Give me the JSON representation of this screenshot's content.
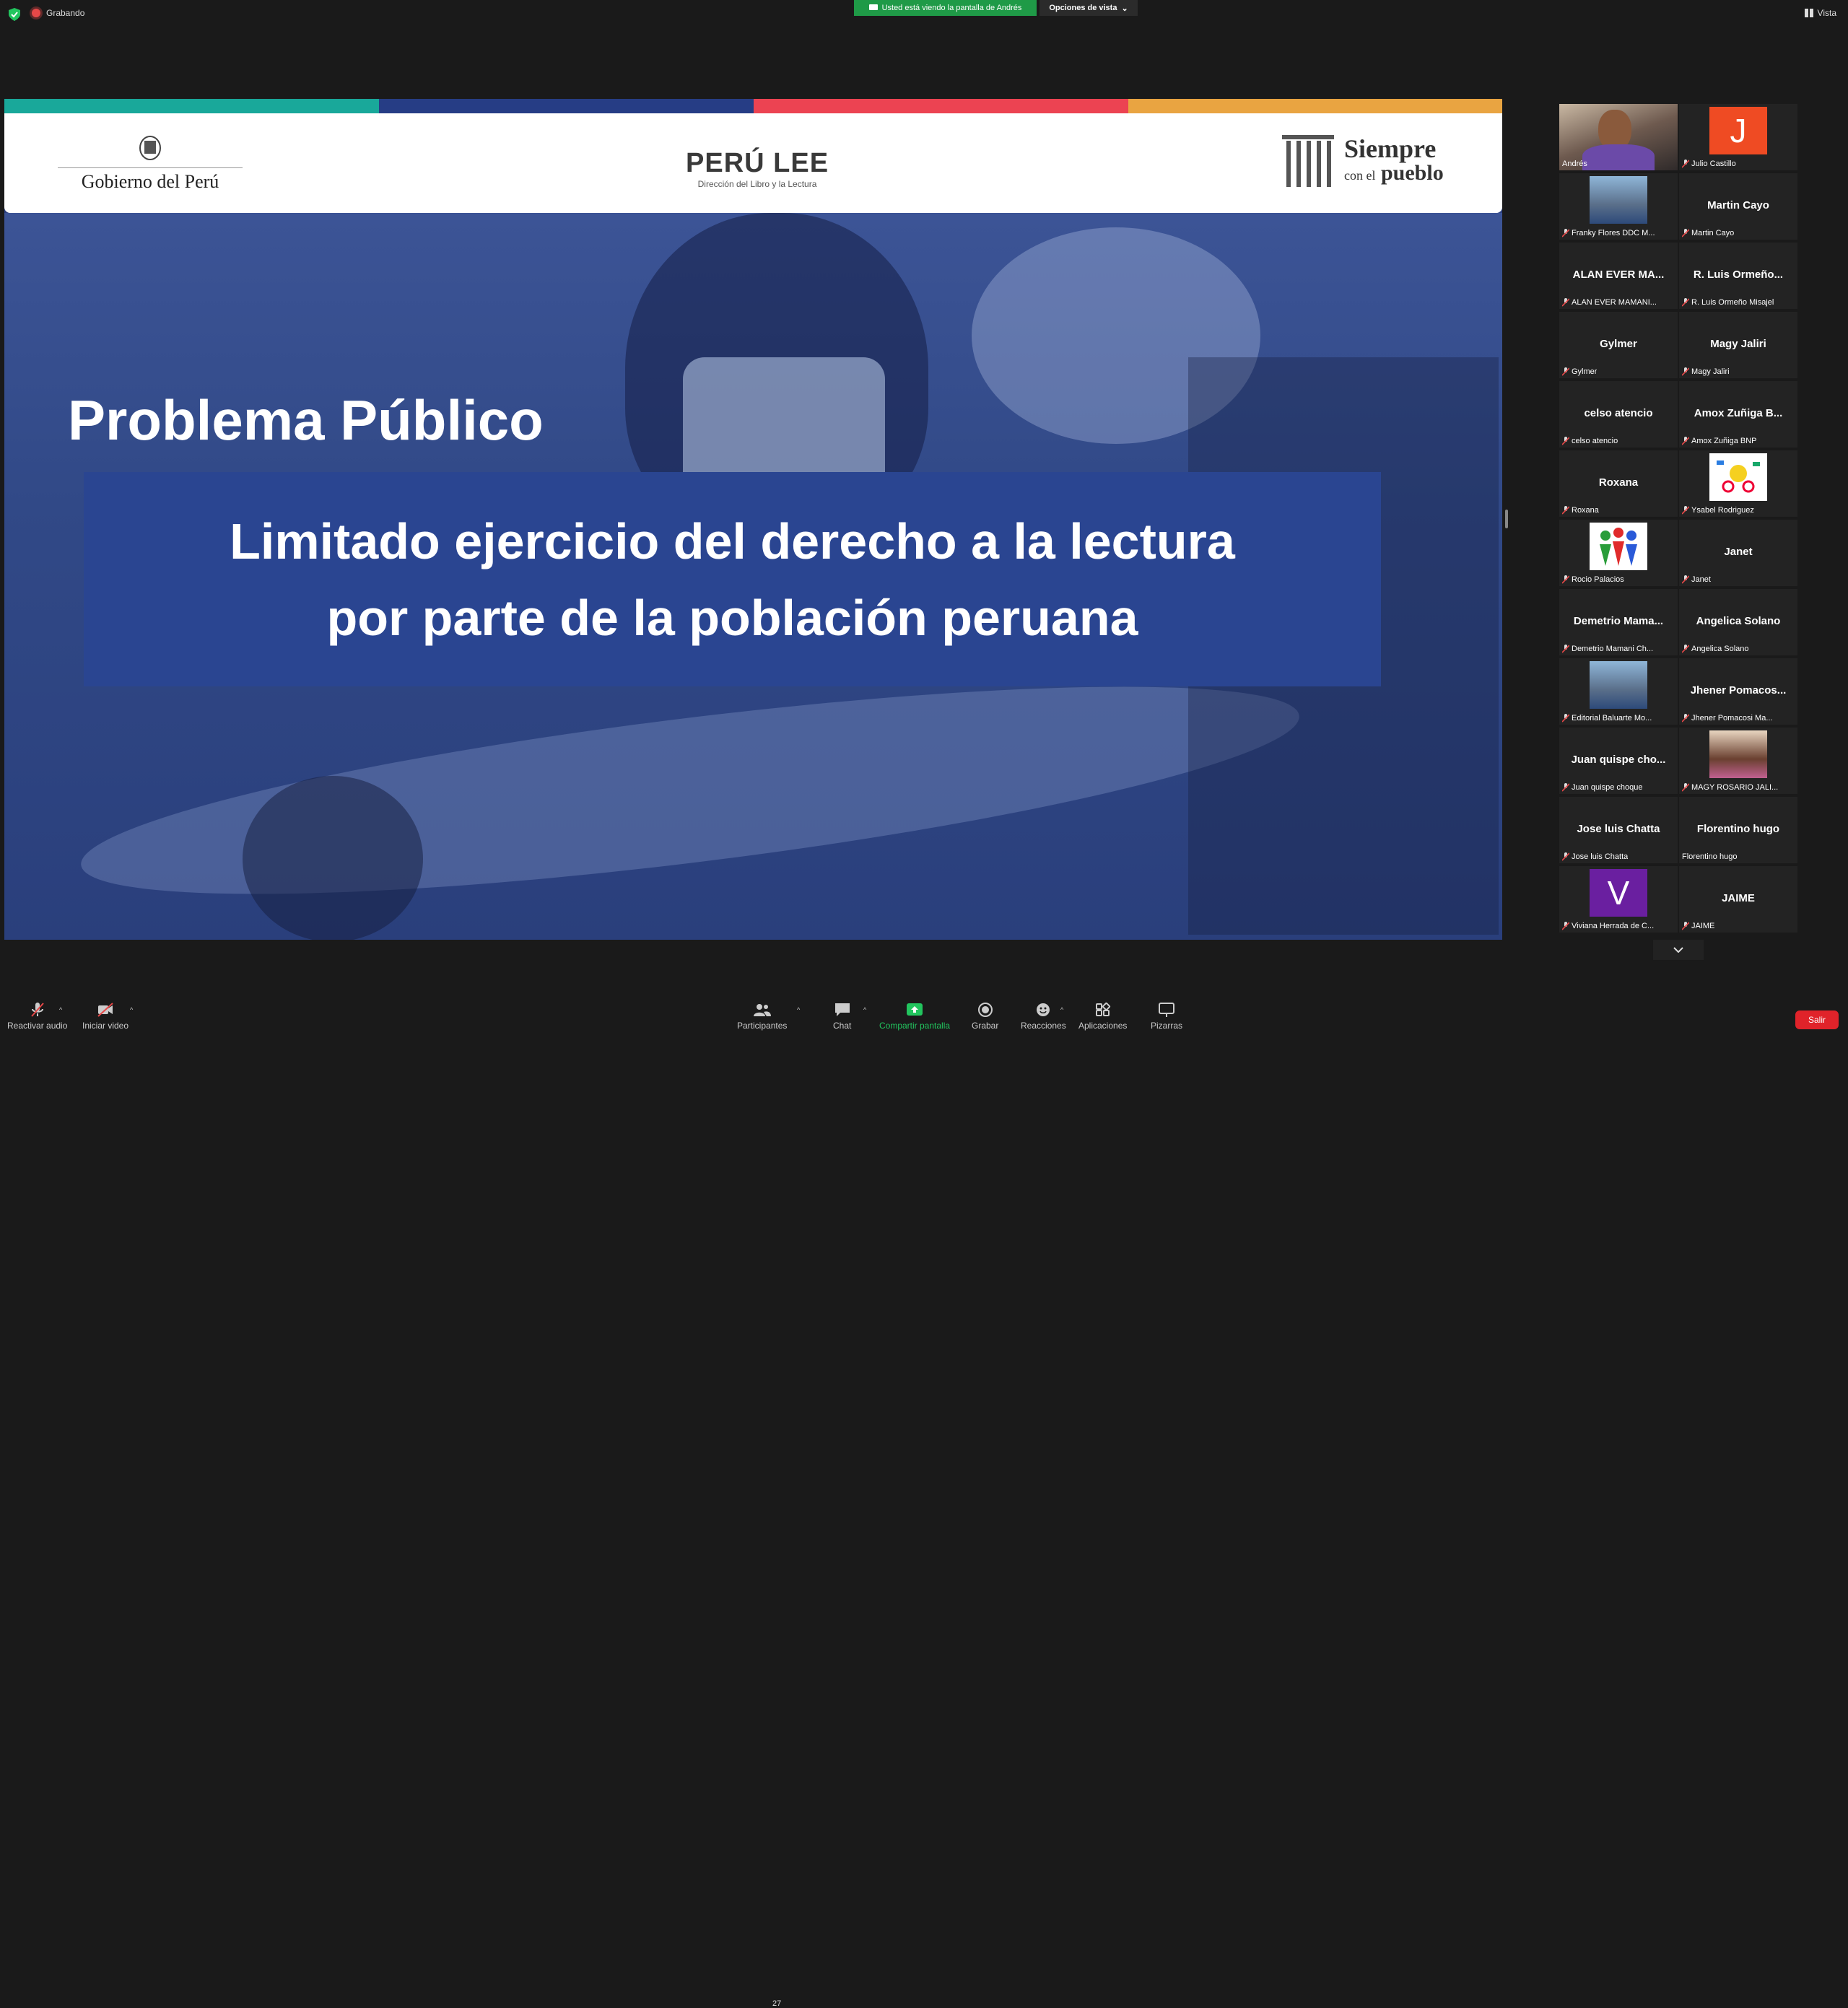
{
  "top": {
    "recording_label": "Grabando",
    "viewing_banner": "Usted está viendo la pantalla de Andrés",
    "view_options": "Opciones de vista",
    "view_label": "Vista"
  },
  "slide": {
    "gov_logo_text": "Gobierno del Perú",
    "peru_lee_text": "PERÚ LEE",
    "peru_lee_sub": "Dirección del Libro y la Lectura",
    "siempre_line1": "Siempre",
    "siempre_line2_small": "con el",
    "siempre_line2": "pueblo",
    "title": "Problema Público",
    "box_line1": "Limitado ejercicio del derecho a la lectura",
    "box_line2": "por parte de la población peruana",
    "stripe_colors": [
      "#19a89a",
      "#263d85",
      "#ec4352",
      "#e9a441"
    ]
  },
  "participants": [
    {
      "display": "",
      "label": "Andrés",
      "type": "video",
      "muted": false,
      "active": true
    },
    {
      "display": "J",
      "label": "Julio Castillo",
      "type": "letter",
      "color": "#ef4b23",
      "muted": true
    },
    {
      "display": "",
      "label": "Franky Flores DDC M...",
      "type": "photo",
      "muted": true
    },
    {
      "display": "Martin Cayo",
      "label": "Martin Cayo",
      "type": "name",
      "muted": true
    },
    {
      "display": "ALAN EVER MA...",
      "label": "ALAN EVER MAMANI...",
      "type": "name",
      "muted": true
    },
    {
      "display": "R. Luis Ormeño...",
      "label": "R. Luis Ormeño Misajel",
      "type": "name",
      "muted": true
    },
    {
      "display": "Gylmer",
      "label": "Gylmer",
      "type": "name",
      "muted": true
    },
    {
      "display": "Magy Jaliri",
      "label": "Magy Jaliri",
      "type": "name",
      "muted": true
    },
    {
      "display": "celso atencio",
      "label": "celso atencio",
      "type": "name",
      "muted": true
    },
    {
      "display": "Amox Zuñiga B...",
      "label": "Amox Zuñiga BNP",
      "type": "name",
      "muted": true
    },
    {
      "display": "Roxana",
      "label": "Roxana",
      "type": "name",
      "muted": true
    },
    {
      "display": "",
      "label": "Ysabel Rodriguez",
      "type": "logo",
      "muted": true
    },
    {
      "display": "",
      "label": "Rocio Palacios",
      "type": "logo2",
      "muted": true
    },
    {
      "display": "Janet",
      "label": "Janet",
      "type": "name",
      "muted": true
    },
    {
      "display": "Demetrio  Mama...",
      "label": "Demetrio Mamani Ch...",
      "type": "name",
      "muted": true
    },
    {
      "display": "Angelica Solano",
      "label": "Angelica Solano",
      "type": "name",
      "muted": true
    },
    {
      "display": "",
      "label": "Editorial Baluarte Mo...",
      "type": "photo",
      "muted": true
    },
    {
      "display": "Jhener  Pomacos...",
      "label": "Jhener Pomacosi Ma...",
      "type": "name",
      "muted": true
    },
    {
      "display": "Juan quispe cho...",
      "label": "Juan quispe choque",
      "type": "name",
      "muted": true
    },
    {
      "display": "",
      "label": "MAGY ROSARIO JALI...",
      "type": "photo2",
      "muted": true
    },
    {
      "display": "Jose luis Chatta",
      "label": "Jose luis Chatta",
      "type": "name",
      "muted": true
    },
    {
      "display": "Florentino hugo",
      "label": "Florentino hugo",
      "type": "name",
      "muted": false
    },
    {
      "display": "V",
      "label": "Viviana Herrada de C...",
      "type": "letter",
      "color": "#6a1fa0",
      "muted": true
    },
    {
      "display": "JAIME",
      "label": "JAIME",
      "type": "name",
      "muted": true
    }
  ],
  "toolbar": {
    "audio": "Reactivar audio",
    "video": "Iniciar video",
    "participants": "Participantes",
    "participants_count": "27",
    "chat": "Chat",
    "share": "Compartir pantalla",
    "record": "Grabar",
    "reactions": "Reacciones",
    "apps": "Aplicaciones",
    "whiteboards": "Pizarras",
    "leave": "Salir"
  }
}
